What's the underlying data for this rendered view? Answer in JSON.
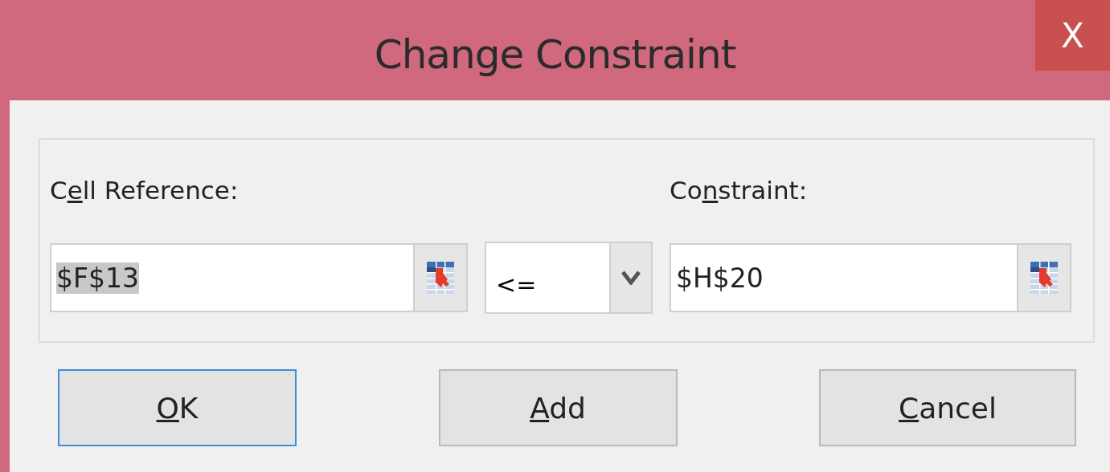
{
  "window": {
    "title": "Change Constraint",
    "close": "X"
  },
  "cell_reference": {
    "label": {
      "before": "C",
      "key": "e",
      "after": "ll Reference:"
    },
    "value": "$F$13",
    "value_selected": true
  },
  "operator": {
    "value": "<="
  },
  "constraint": {
    "label": {
      "before": "Co",
      "key": "n",
      "after": "straint:"
    },
    "value": "$H$20"
  },
  "buttons": [
    {
      "label": {
        "key": "O",
        "after": "K"
      },
      "default": true
    },
    {
      "label": {
        "key": "A",
        "after": "dd"
      },
      "default": false
    },
    {
      "label": {
        "key": "C",
        "after": "ancel"
      },
      "default": false
    }
  ]
}
